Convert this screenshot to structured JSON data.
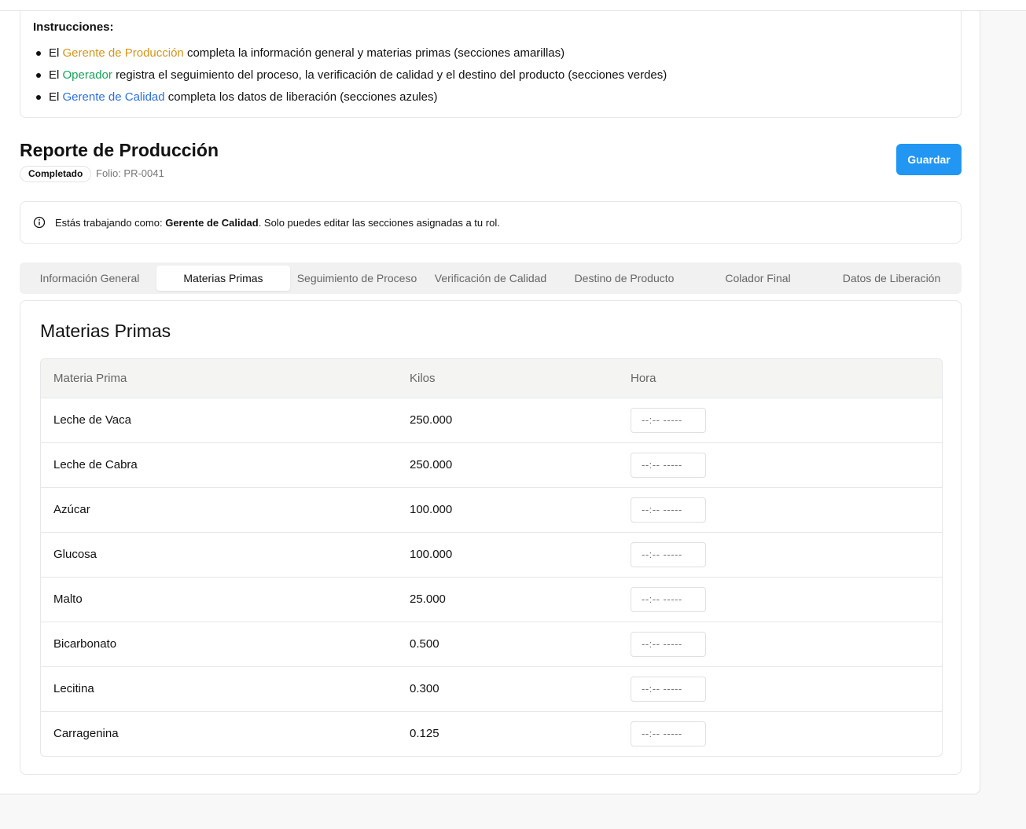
{
  "instructions": {
    "title": "Instrucciones:",
    "items": [
      {
        "prefix": "El",
        "role": "Gerente de Producción",
        "text": "completa la información general y materias primas (secciones amarillas)"
      },
      {
        "prefix": "El",
        "role": "Operador",
        "text": "registra el seguimiento del proceso, la verificación de calidad y el destino del producto (secciones verdes)"
      },
      {
        "prefix": "El",
        "role": "Gerente de Calidad",
        "text": "completa los datos de liberación (secciones azules)"
      }
    ]
  },
  "colors": {
    "production_role": "#d4951a",
    "operator_role": "#18a45a",
    "quality_role": "#2c6fe0",
    "save_button": "#2196f3"
  },
  "report": {
    "title": "Reporte de Producción",
    "status": "Completado",
    "folio": "Folio: PR-0041",
    "save_label": "Guardar"
  },
  "info": {
    "prefix": "Estás trabajando como:",
    "role": "Gerente de Calidad",
    "suffix": ". Solo puedes editar las secciones asignadas a tu rol.",
    "icon": "info-icon"
  },
  "tabs": [
    {
      "label": "Información General",
      "active": false
    },
    {
      "label": "Materias Primas",
      "active": true
    },
    {
      "label": "Seguimiento de Proceso",
      "active": false
    },
    {
      "label": "Verificación de Calidad",
      "active": false
    },
    {
      "label": "Destino de Producto",
      "active": false
    },
    {
      "label": "Colador Final",
      "active": false
    },
    {
      "label": "Datos de Liberación",
      "active": false
    }
  ],
  "section": {
    "title": "Materias Primas",
    "columns": [
      "Materia Prima",
      "Kilos",
      "Hora"
    ],
    "time_placeholder": "--:-- -----",
    "rows": [
      {
        "name": "Leche de Vaca",
        "kilos": "250.000",
        "hora": ""
      },
      {
        "name": "Leche de Cabra",
        "kilos": "250.000",
        "hora": ""
      },
      {
        "name": "Azúcar",
        "kilos": "100.000",
        "hora": ""
      },
      {
        "name": "Glucosa",
        "kilos": "100.000",
        "hora": ""
      },
      {
        "name": "Malto",
        "kilos": "25.000",
        "hora": ""
      },
      {
        "name": "Bicarbonato",
        "kilos": "0.500",
        "hora": ""
      },
      {
        "name": "Lecitina",
        "kilos": "0.300",
        "hora": ""
      },
      {
        "name": "Carragenina",
        "kilos": "0.125",
        "hora": ""
      }
    ]
  }
}
